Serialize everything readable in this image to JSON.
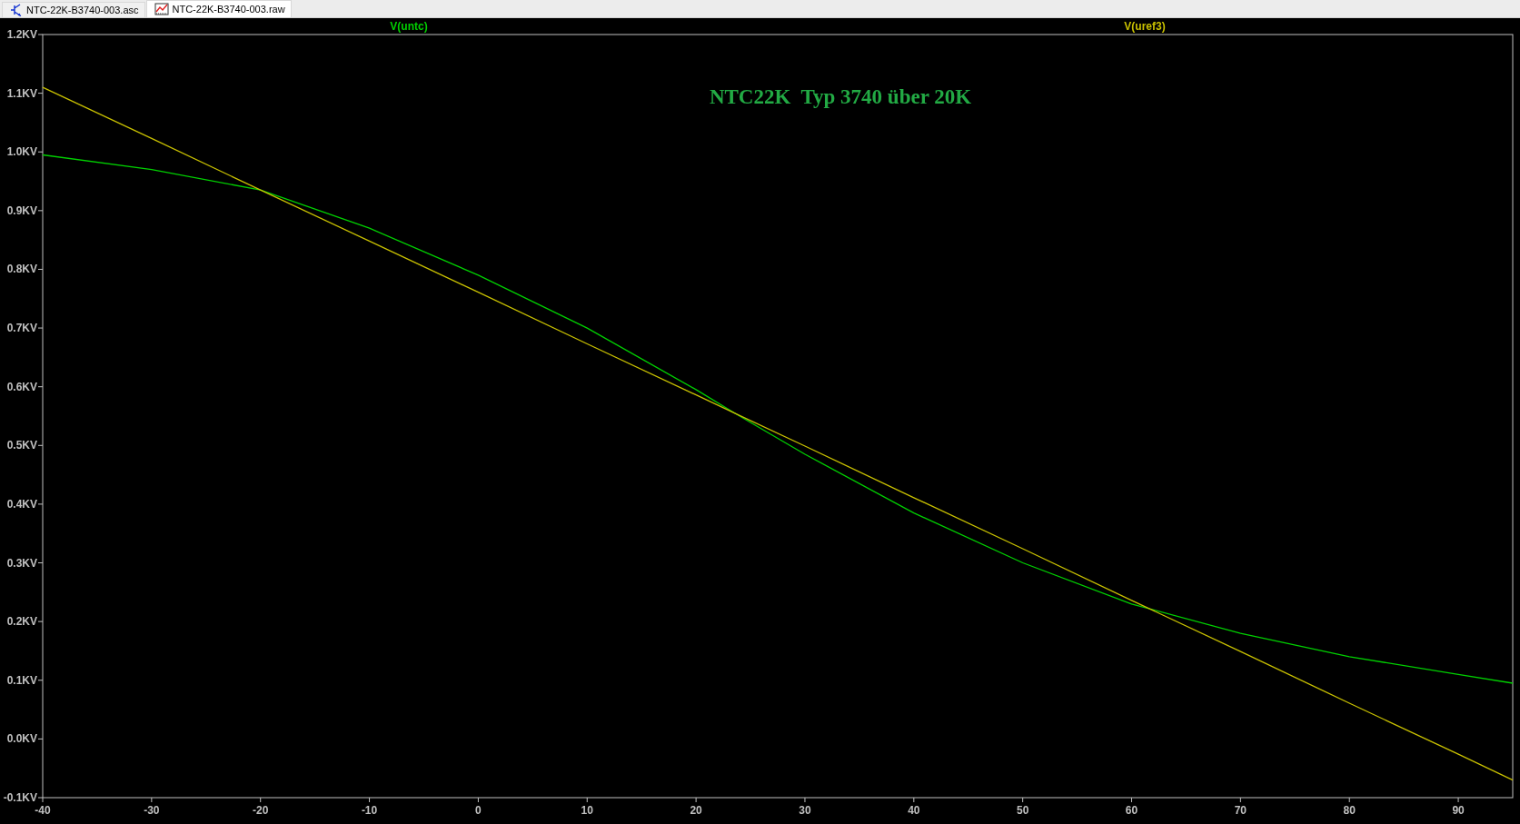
{
  "tabs": [
    {
      "label": "NTC-22K-B3740-003.asc",
      "kind": "schematic",
      "selected": false
    },
    {
      "label": "NTC-22K-B3740-003.raw",
      "kind": "waveform",
      "selected": true
    }
  ],
  "plot": {
    "chart_data": {
      "type": "line",
      "x": [
        -40,
        -30,
        -20,
        -10,
        0,
        10,
        20,
        24,
        30,
        40,
        50,
        60,
        70,
        80,
        90,
        95
      ],
      "series": [
        {
          "name": "V(untc)",
          "color": "#00d000",
          "values": [
            0.995,
            0.97,
            0.935,
            0.87,
            0.79,
            0.7,
            0.595,
            0.55,
            0.485,
            0.385,
            0.3,
            0.23,
            0.18,
            0.14,
            0.11,
            0.095
          ]
        },
        {
          "name": "V(uref3)",
          "color": "#c8c000",
          "values": [
            1.11,
            1.023,
            0.935,
            0.848,
            0.761,
            0.673,
            0.586,
            0.551,
            0.499,
            0.411,
            0.324,
            0.236,
            0.149,
            0.061,
            -0.026,
            -0.07
          ]
        }
      ],
      "xlim": [
        -40,
        95
      ],
      "ylim": [
        -0.1,
        1.2
      ],
      "xticks": [
        -40,
        -30,
        -20,
        -10,
        0,
        10,
        20,
        30,
        40,
        50,
        60,
        70,
        80,
        90
      ],
      "yticks": [
        {
          "value": 1.2,
          "label": "1.2KV"
        },
        {
          "value": 1.1,
          "label": "1.1KV"
        },
        {
          "value": 1.0,
          "label": "1.0KV"
        },
        {
          "value": 0.9,
          "label": "0.9KV"
        },
        {
          "value": 0.8,
          "label": "0.8KV"
        },
        {
          "value": 0.7,
          "label": "0.7KV"
        },
        {
          "value": 0.6,
          "label": "0.6KV"
        },
        {
          "value": 0.5,
          "label": "0.5KV"
        },
        {
          "value": 0.4,
          "label": "0.4KV"
        },
        {
          "value": 0.3,
          "label": "0.3KV"
        },
        {
          "value": 0.2,
          "label": "0.2KV"
        },
        {
          "value": 0.1,
          "label": "0.1KV"
        },
        {
          "value": 0.0,
          "label": "0.0KV"
        },
        {
          "value": -0.1,
          "label": "-0.1KV"
        }
      ],
      "annotations": [
        "NTC22K  Typ 3740 über 20K"
      ]
    }
  }
}
